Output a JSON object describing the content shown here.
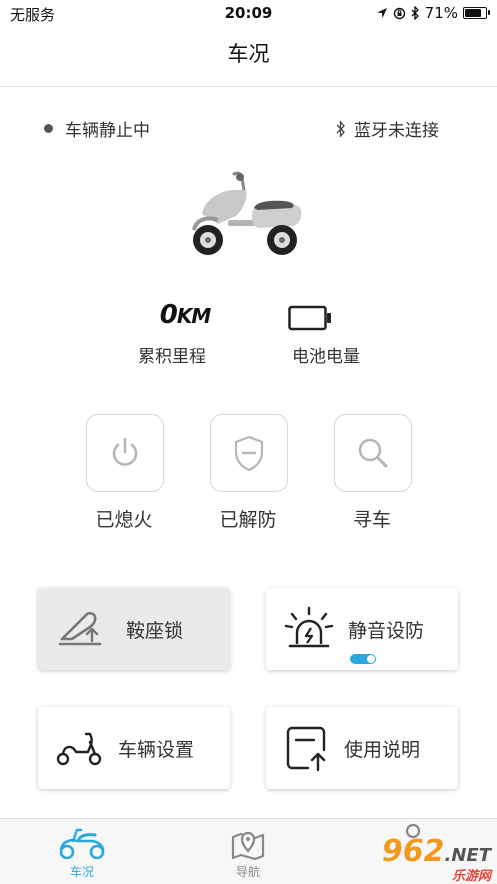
{
  "status_bar": {
    "carrier": "无服务",
    "time": "20:09",
    "battery_percent": "71%",
    "battery_level": 0.71
  },
  "nav": {
    "title": "车况"
  },
  "vehicle": {
    "state": "车辆静止中",
    "bluetooth": "蓝牙未连接"
  },
  "stats": {
    "mileage_value": "0",
    "mileage_unit": "KM",
    "mileage_label": "累积里程",
    "battery_label": "电池电量"
  },
  "controls": [
    {
      "label": "已熄火",
      "icon": "power-icon"
    },
    {
      "label": "已解防",
      "icon": "shield-icon"
    },
    {
      "label": "寻车",
      "icon": "search-icon"
    }
  ],
  "cards": {
    "seat_lock": "鞍座锁",
    "silent_arm": "静音设防",
    "silent_arm_toggle_on": true,
    "vehicle_settings": "车辆设置",
    "manual": "使用说明"
  },
  "tabs": [
    {
      "label": "车况",
      "active": true,
      "icon": "scooter-icon"
    },
    {
      "label": "导航",
      "active": false,
      "icon": "map-pin-icon"
    }
  ],
  "watermark": {
    "number": "962",
    "suffix": ".NET",
    "site": "乐游网"
  },
  "colors": {
    "accent": "#29a8e0",
    "text": "#333333",
    "divider": "#e4e4e4"
  }
}
